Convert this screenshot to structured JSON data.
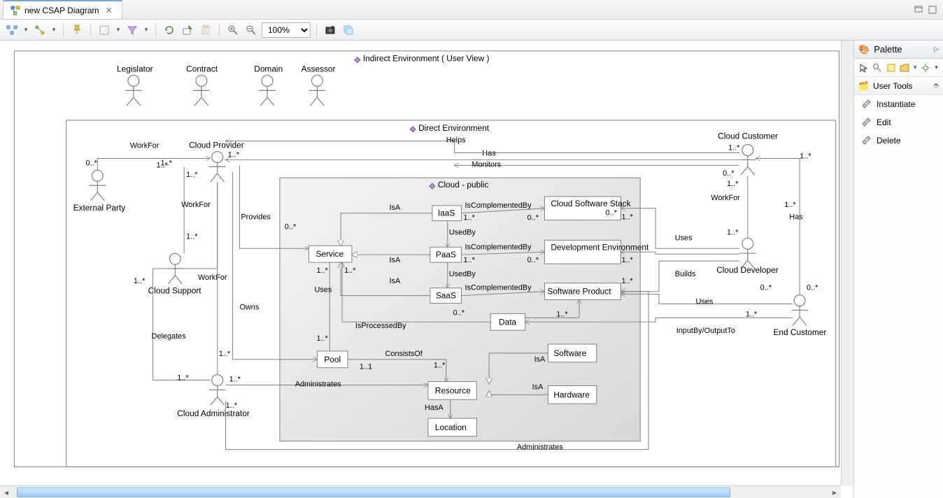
{
  "tab": {
    "title": "new CSAP Diagram"
  },
  "zoom": "100%",
  "palette": {
    "title": "Palette",
    "section": "User Tools",
    "items": [
      "Instantiate",
      "Edit",
      "Delete"
    ]
  },
  "labels": {
    "indirect": "Indirect Environment ( User View )",
    "direct": "Direct Environment",
    "cloud": "Cloud - public",
    "legislator": "Legislator",
    "contract": "Contract",
    "domain": "Domain",
    "assessor": "Assessor",
    "external": "External Party",
    "cloudprov": "Cloud Provider",
    "cloudsupport": "Cloud Support",
    "cloudadmin": "Cloud Administrator",
    "cloudcust": "Cloud Customer",
    "clouddev": "Cloud Developer",
    "endcust": "End Customer",
    "service": "Service",
    "iaas": "IaaS",
    "paas": "PaaS",
    "saas": "SaaS",
    "css": "Cloud Software Stack",
    "devenv": "Development Environment",
    "swprod": "Software Product",
    "data": "Data",
    "pool": "Pool",
    "resource": "Resource",
    "location": "Location",
    "software": "Software",
    "hardware": "Hardware"
  },
  "rel": {
    "workfor": "WorkFor",
    "has": "Has",
    "helps": "Helps",
    "monitors": "Monitors",
    "provides": "Provides",
    "owns": "Owns",
    "delegates": "Delegates",
    "administrates": "Administrates",
    "isa": "IsA",
    "usedby": "UsedBy",
    "iscomp": "IsComplementedBy",
    "isproc": "IsProcessedBy",
    "consists": "ConsistsOf",
    "hasa": "HasA",
    "uses": "Uses",
    "builds": "Builds",
    "inputoutput": "InputBy/OutputTo"
  },
  "mult": {
    "zs": "0..*",
    "os": "1..*",
    "oo": "1..1"
  }
}
